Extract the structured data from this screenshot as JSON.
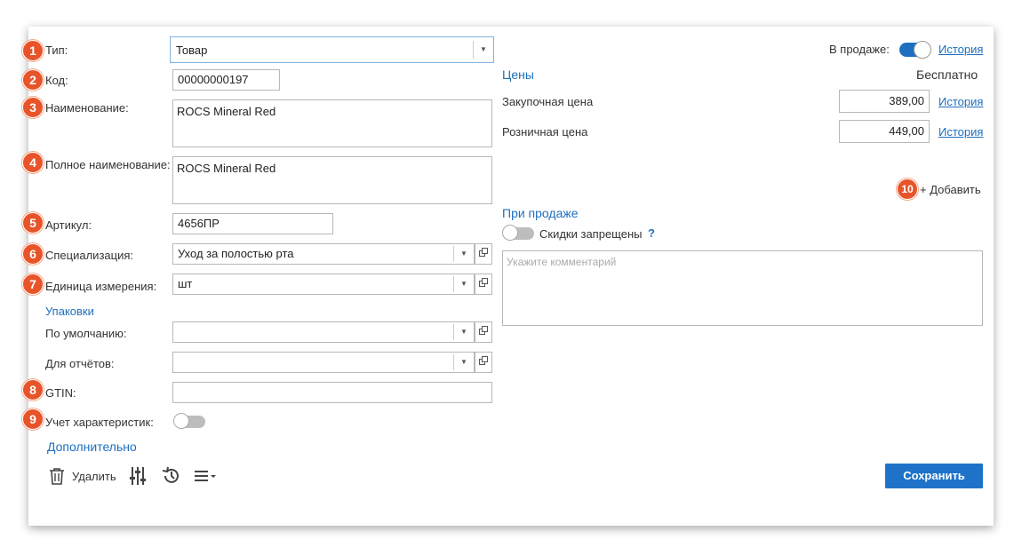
{
  "fields": {
    "type_label": "Тип:",
    "type_value": "Товар",
    "code_label": "Код:",
    "code_value": "00000000197",
    "name_label": "Наименование:",
    "name_value": "ROCS Mineral Red",
    "fullname_label": "Полное наименование:",
    "fullname_value": "ROCS Mineral Red",
    "article_label": "Артикул:",
    "article_value": "4656ПР",
    "specialization_label": "Специализация:",
    "specialization_value": "Уход за полостью рта",
    "unit_label": "Единица измерения:",
    "unit_value": "шт",
    "packages_header": "Упаковки",
    "default_label": "По умолчанию:",
    "default_value": "",
    "reports_label": "Для отчётов:",
    "reports_value": "",
    "gtin_label": "GTIN:",
    "gtin_value": "",
    "characteristics_label": "Учет характеристик:",
    "characteristics_on": false,
    "additional_link": "Дополнительно"
  },
  "badges": [
    "1",
    "2",
    "3",
    "4",
    "5",
    "6",
    "7",
    "8",
    "9",
    "10"
  ],
  "sale": {
    "label": "В продаже:",
    "on": true,
    "history_link": "История"
  },
  "prices": {
    "header": "Цены",
    "free_text": "Бесплатно",
    "purchase_label": "Закупочная цена",
    "purchase_value": "389,00",
    "retail_label": "Розничная цена",
    "retail_value": "449,00",
    "history_link": "История",
    "add_link": "+ Добавить"
  },
  "on_sale": {
    "header": "При продаже",
    "discounts_label": "Скидки запрещены",
    "discounts_on": false,
    "help": "?",
    "comment_placeholder": "Укажите комментарий"
  },
  "toolbar": {
    "delete_label": "Удалить",
    "save_label": "Сохранить"
  },
  "colors": {
    "accent": "#1e6fbf",
    "badge": "#e8542a",
    "save_button": "#1e73c9"
  },
  "icons": [
    "trash-icon",
    "settings-sliders-icon",
    "history-icon",
    "menu-icon",
    "chevron-down-icon",
    "open-external-icon"
  ]
}
